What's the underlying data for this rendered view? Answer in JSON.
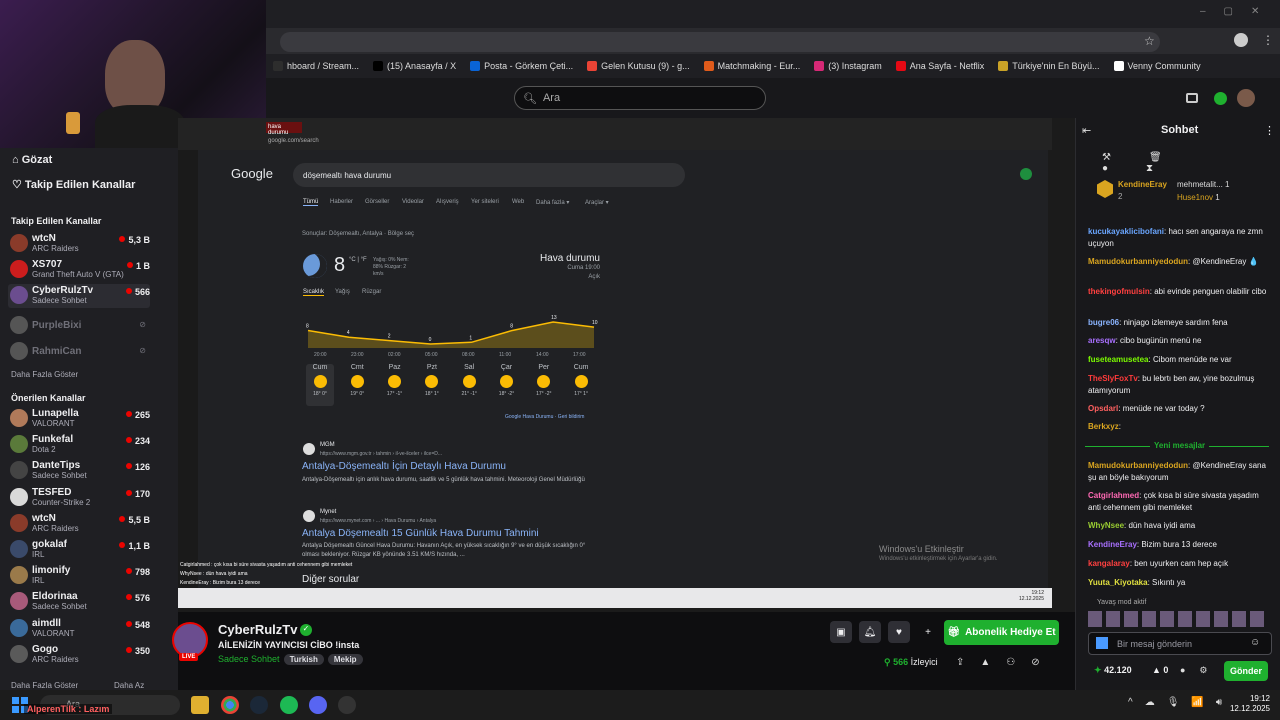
{
  "browser": {
    "bookmarks": [
      {
        "label": "hboard / Stream...",
        "color": "#2d2d2d"
      },
      {
        "label": "(15) Anasayfa / X",
        "color": "#000000"
      },
      {
        "label": "Posta - Görkem Çeti...",
        "color": "#0a64d6"
      },
      {
        "label": "Gelen Kutusu (9) - g...",
        "color": "#ea4335"
      },
      {
        "label": "Matchmaking - Eur...",
        "color": "#e05b1b"
      },
      {
        "label": "(3) Instagram",
        "color": "#d62976"
      },
      {
        "label": "Ana Sayfa - Netflix",
        "color": "#e50914"
      },
      {
        "label": "Türkiye'nin En Büyü...",
        "color": "#c9a227"
      },
      {
        "label": "Venny Community",
        "color": "#ffffff"
      }
    ]
  },
  "twitch": {
    "search_placeholder": "Ara",
    "chat_title": "Sohbet",
    "sidebar": {
      "browse": "Gözat",
      "following_link": "Takip Edilen Kanallar",
      "followed_header": "Takip Edilen Kanallar",
      "followed": [
        {
          "name": "wtcN",
          "game": "ARC Raiders",
          "viewers": "5,3 B",
          "avatar": "#8a3b2a"
        },
        {
          "name": "XS707",
          "game": "Grand Theft Auto V (GTA)",
          "viewers": "1 B",
          "avatar": "#cc1d1d"
        },
        {
          "name": "CyberRulzTv",
          "game": "Sadece Sohbet",
          "viewers": "566",
          "avatar": "#6b4d8f"
        }
      ],
      "offline": [
        {
          "name": "PurpleBixi"
        },
        {
          "name": "RahmiCan"
        }
      ],
      "show_more": "Daha Fazla Göster",
      "recommended_header": "Önerilen Kanallar",
      "recommended": [
        {
          "name": "Lunapella",
          "game": "VALORANT",
          "viewers": "265",
          "avatar": "#b07a5a"
        },
        {
          "name": "Funkefal",
          "game": "Dota 2",
          "viewers": "234",
          "avatar": "#5a7a3a"
        },
        {
          "name": "DanteTips",
          "game": "Sadece Sohbet",
          "viewers": "126",
          "avatar": "#444444"
        },
        {
          "name": "TESFED",
          "game": "Counter-Strike 2",
          "viewers": "170",
          "avatar": "#d9d9d9"
        },
        {
          "name": "wtcN",
          "game": "ARC Raiders",
          "viewers": "5,5 B",
          "avatar": "#8a3b2a"
        },
        {
          "name": "gokalaf",
          "game": "IRL",
          "viewers": "1,1 B",
          "avatar": "#3a4a6a"
        },
        {
          "name": "limonify",
          "game": "IRL",
          "viewers": "798",
          "avatar": "#9a7a4a"
        },
        {
          "name": "Eldorinaa",
          "game": "Sadece Sohbet",
          "viewers": "576",
          "avatar": "#a85a7a"
        },
        {
          "name": "aimdll",
          "game": "VALORANT",
          "viewers": "548",
          "avatar": "#3a6a9a"
        },
        {
          "name": "Gogo",
          "game": "ARC Raiders",
          "viewers": "350",
          "avatar": "#5a5a5a"
        }
      ],
      "show_more2": "Daha Fazla Göster",
      "show_less": "Daha Az"
    },
    "channel": {
      "name": "CyberRulzTv",
      "title": "AİLENİZİN YAYINCISI CİBO !insta",
      "category": "Sadece Sohbet",
      "tags": [
        "Turkish",
        "Mekip"
      ],
      "live_badge": "LIVE",
      "viewers": "566",
      "viewers_label": "İzleyici",
      "gift_sub": "Abonelik Hediye Et"
    },
    "chat": {
      "top_gifter": "KendineEray",
      "top_gifter_count": "2",
      "gifters": [
        {
          "name": "mehmetalit...",
          "count": "1"
        },
        {
          "name": "Huse1nov",
          "count": "1"
        }
      ],
      "messages": [
        {
          "user": "kucukayaklicibofani",
          "color": "#6aa6ff",
          "text": "hacı sen angaraya ne zmn uçuyon"
        },
        {
          "user": "Mamudokurbanniyedodun",
          "color": "#daa520",
          "text": "@KendineEray 💧"
        },
        {
          "user": "thekingofmulsin",
          "color": "#ff4040",
          "text": "abi evinde penguen olabilir cibo"
        },
        {
          "user": "bugre06",
          "color": "#8ab4ff",
          "text": "ninjago izlemeye sardım fena"
        },
        {
          "user": "aresqw",
          "color": "#a970ff",
          "text": "cibo bugünün menü ne"
        },
        {
          "user": "fuseteamusetea",
          "color": "#7cfc00",
          "text": "Cibom menüde ne var"
        },
        {
          "user": "TheSlyFoxTv",
          "color": "#ff3b3b",
          "text": "bu lebrtı ben aw, yine bozulmuş atamıyorum"
        },
        {
          "user": "Opsdarl",
          "color": "#ff6060",
          "text": "menüde ne var today ?"
        },
        {
          "user": "Berkxyz",
          "color": "#daa520",
          "text": ""
        },
        {
          "user": "Mamudokurbanniyedodun",
          "color": "#daa520",
          "text": "@KendineEray sana şu an böyle bakıyorum"
        },
        {
          "user": "Catgirlahmed",
          "color": "#ff69b4",
          "text": "çok kısa bi süre sivasta yaşadım anti cehennem gibi memleket"
        },
        {
          "user": "WhyNsee",
          "color": "#9acd32",
          "text": "dün hava iyidi ama"
        },
        {
          "user": "KendineEray",
          "color": "#a970ff",
          "text": "Bizim bura 13 derece"
        },
        {
          "user": "kangalaray",
          "color": "#ff4040",
          "text": "ben uyurken cam hep açık"
        },
        {
          "user": "Yuuta_Kiyotaka",
          "color": "#e0e040",
          "text": "Sıkıntı ya"
        }
      ],
      "new_messages": "Yeni mesajlar",
      "slow_mode": "Yavaş mod aktif",
      "input_placeholder": "Bir mesaj gönderin",
      "points": "42.120",
      "zero": "0",
      "send": "Gönder"
    }
  },
  "stream": {
    "inner_tab": "hava durumu",
    "inner_url": "google.com/search",
    "google_logo": "Google",
    "query": "döşemealtı hava durumu",
    "tabs": [
      "Tümü",
      "Haberler",
      "Görseller",
      "Videolar",
      "Alışveriş",
      "Yer siteleri",
      "Web",
      "Daha fazla ▾",
      "Araçlar ▾"
    ],
    "results_for": "Sonuçlar: Döşemealtı, Antalya · Bölge seç",
    "temp": "8",
    "unit": "°C | °F",
    "details": "Yağış: 0%  Nem: 88%  Rüzgar: 2 km/s",
    "weather_title": "Hava durumu",
    "weather_time": "Cuma 19:00",
    "weather_cond": "Açık",
    "w_tabs": [
      "Sıcaklık",
      "Yağış",
      "Rüzgar"
    ],
    "hours": [
      "20:00",
      "23:00",
      "02:00",
      "05:00",
      "08:00",
      "11:00",
      "14:00",
      "17:00"
    ],
    "chart_values": [
      "8",
      "4",
      "2",
      "0",
      "1",
      "8",
      "13",
      "10"
    ],
    "days": [
      {
        "d": "Cum",
        "t": "18° 0°"
      },
      {
        "d": "Cmt",
        "t": "19° 0°"
      },
      {
        "d": "Paz",
        "t": "17° -1°"
      },
      {
        "d": "Pzt",
        "t": "18° 1°"
      },
      {
        "d": "Sal",
        "t": "21° -1°"
      },
      {
        "d": "Çar",
        "t": "18° -2°"
      },
      {
        "d": "Per",
        "t": "17° -2°"
      },
      {
        "d": "Cum",
        "t": "17° 1°"
      }
    ],
    "google_weather": "Google Hava Durumu · Geri bildirim",
    "result1_site": "MGM",
    "result1_url": "https://www.mgm.gov.tr › tahmin › il-ve-ilceler › ilce=D...",
    "result1_title": "Antalya-Döşemealtı İçin Detaylı Hava Durumu",
    "result1_desc": "Antalya-Döşemealtı için anlık hava durumu, saatlik ve 5 günlük hava tahmini. Meteoroloji Genel Müdürlüğü",
    "result2_site": "Mynet",
    "result2_url": "https://www.mynet.com › ... › Hava Durumu › Antalya",
    "result2_title": "Antalya Döşemealtı 15 Günlük Hava Durumu Tahmini",
    "result2_desc": "Antalya Döşemealtı Güncel Hava Durumu: Havanın Açık, en yüksek sıcaklığın 9° ve en düşük sıcaklığın 0° olması bekleniyor. Rüzgar KB yönünde 3.51 KM/S hızında, ...",
    "other_q": "Diğer sorular",
    "activate": "Windows'u Etkinleştir",
    "activate_sub": "Windows'u etkinleştirmek için Ayarlar'a gidin.",
    "inner_clock": "19:12",
    "inner_date": "12.12.2025",
    "overlay_lines": [
      "Catgirlahmed : çok kısa bi süre sivasta yaşadım anti cehennem gibi memleket",
      "WhyNsee : dün hava iyidi ama",
      "KendineEray : Bizim bura 13 derece"
    ],
    "alert_user": "AlperenTilk : Lazım"
  },
  "taskbar": {
    "search": "Ara",
    "time": "19:12",
    "date": "12.12.2025"
  }
}
